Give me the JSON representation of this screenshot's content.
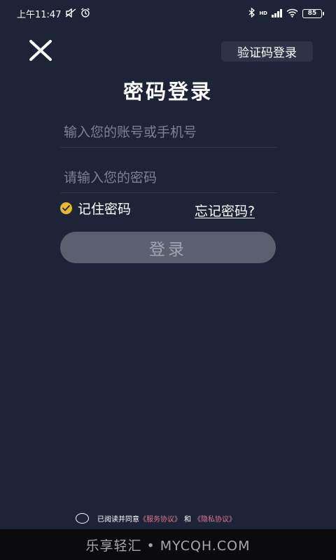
{
  "status_bar": {
    "time": "上午11:47",
    "battery": "85",
    "network": "HD"
  },
  "header": {
    "code_login_label": "验证码登录",
    "title": "密码登录"
  },
  "form": {
    "account_placeholder": "输入您的账号或手机号",
    "account_value": "",
    "password_placeholder": "请输入您的密码",
    "password_value": "",
    "remember_label": "记住密码",
    "remember_checked": true,
    "forgot_label": "忘记密码?",
    "login_label": "登录"
  },
  "agreement": {
    "prefix": "已阅读并同意",
    "service_link": "《服务协议》",
    "and": "和",
    "privacy_link": "《隐私协议》"
  },
  "watermark": {
    "text": "乐享轻汇 • MYCQH.COM"
  },
  "colors": {
    "background": "#1d2438",
    "accent_check": "#e7b92d",
    "link_pink": "#e5768f",
    "login_button_bg": "#5a6070"
  }
}
